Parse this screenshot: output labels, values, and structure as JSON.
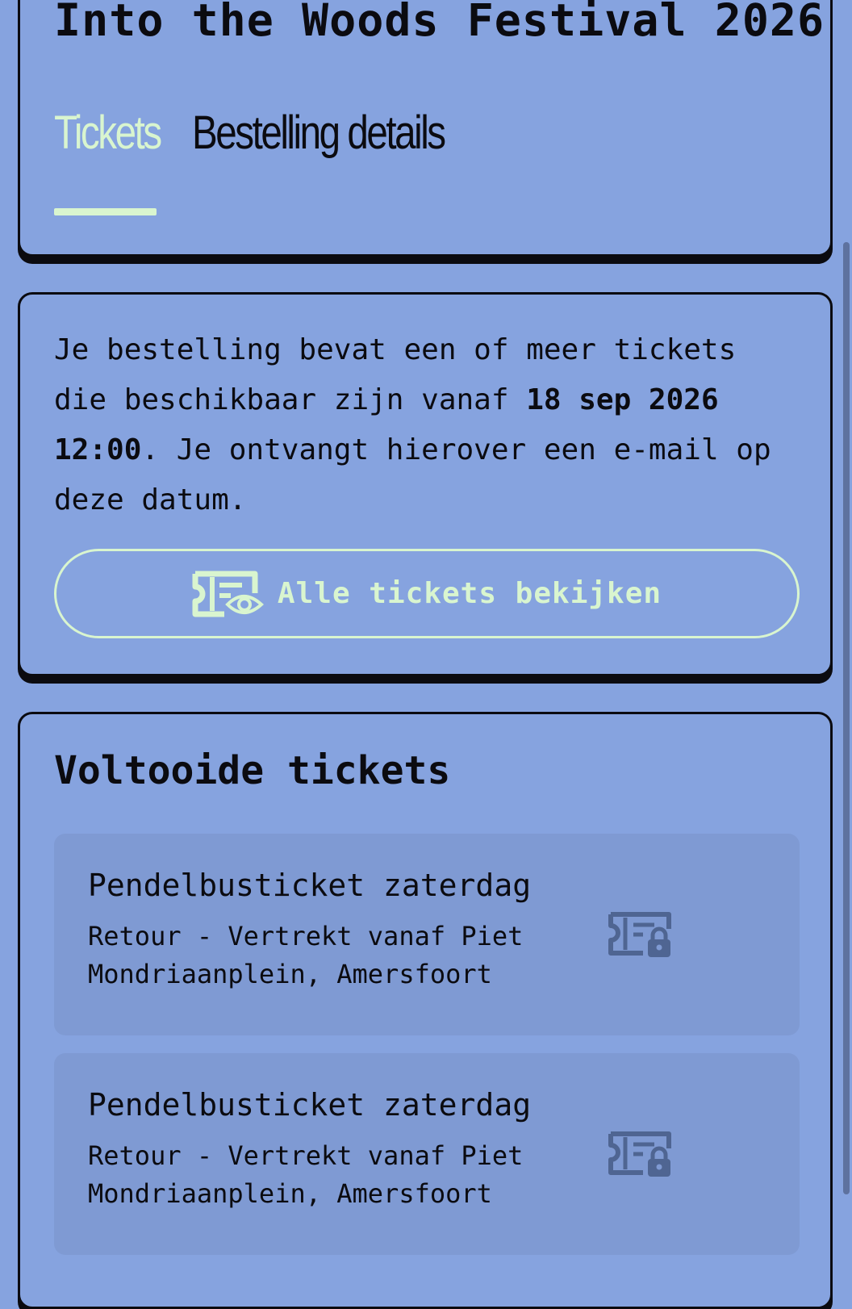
{
  "header": {
    "event_title": "Into the Woods Festival 2026",
    "tabs": [
      {
        "label": "Tickets",
        "active": true
      },
      {
        "label": "Bestelling details",
        "active": false
      }
    ]
  },
  "info": {
    "text_part1": "Je bestelling bevat een of meer tickets die beschikbaar zijn vanaf ",
    "date": "18 sep 2026 12:00",
    "text_part2": ". Je ontvangt hierover een e-mail op deze datum.",
    "view_button_label": "Alle tickets bekijken",
    "view_button_icon": "ticket-eye-icon"
  },
  "completed": {
    "title": "Voltooide tickets",
    "tickets": [
      {
        "name": "Pendelbusticket zaterdag",
        "description": "Retour - Vertrekt vanaf Piet Mondriaanplein, Amersfoort",
        "icon": "ticket-lock-icon"
      },
      {
        "name": "Pendelbusticket zaterdag",
        "description": "Retour - Vertrekt vanaf Piet Mondriaanplein, Amersfoort",
        "icon": "ticket-lock-icon"
      }
    ]
  },
  "colors": {
    "background": "#86a3df",
    "accent": "#d9f5cf",
    "ticket_background": "#7f9ad3",
    "ink": "#0b0b10",
    "icon_muted": "#4f6592"
  }
}
